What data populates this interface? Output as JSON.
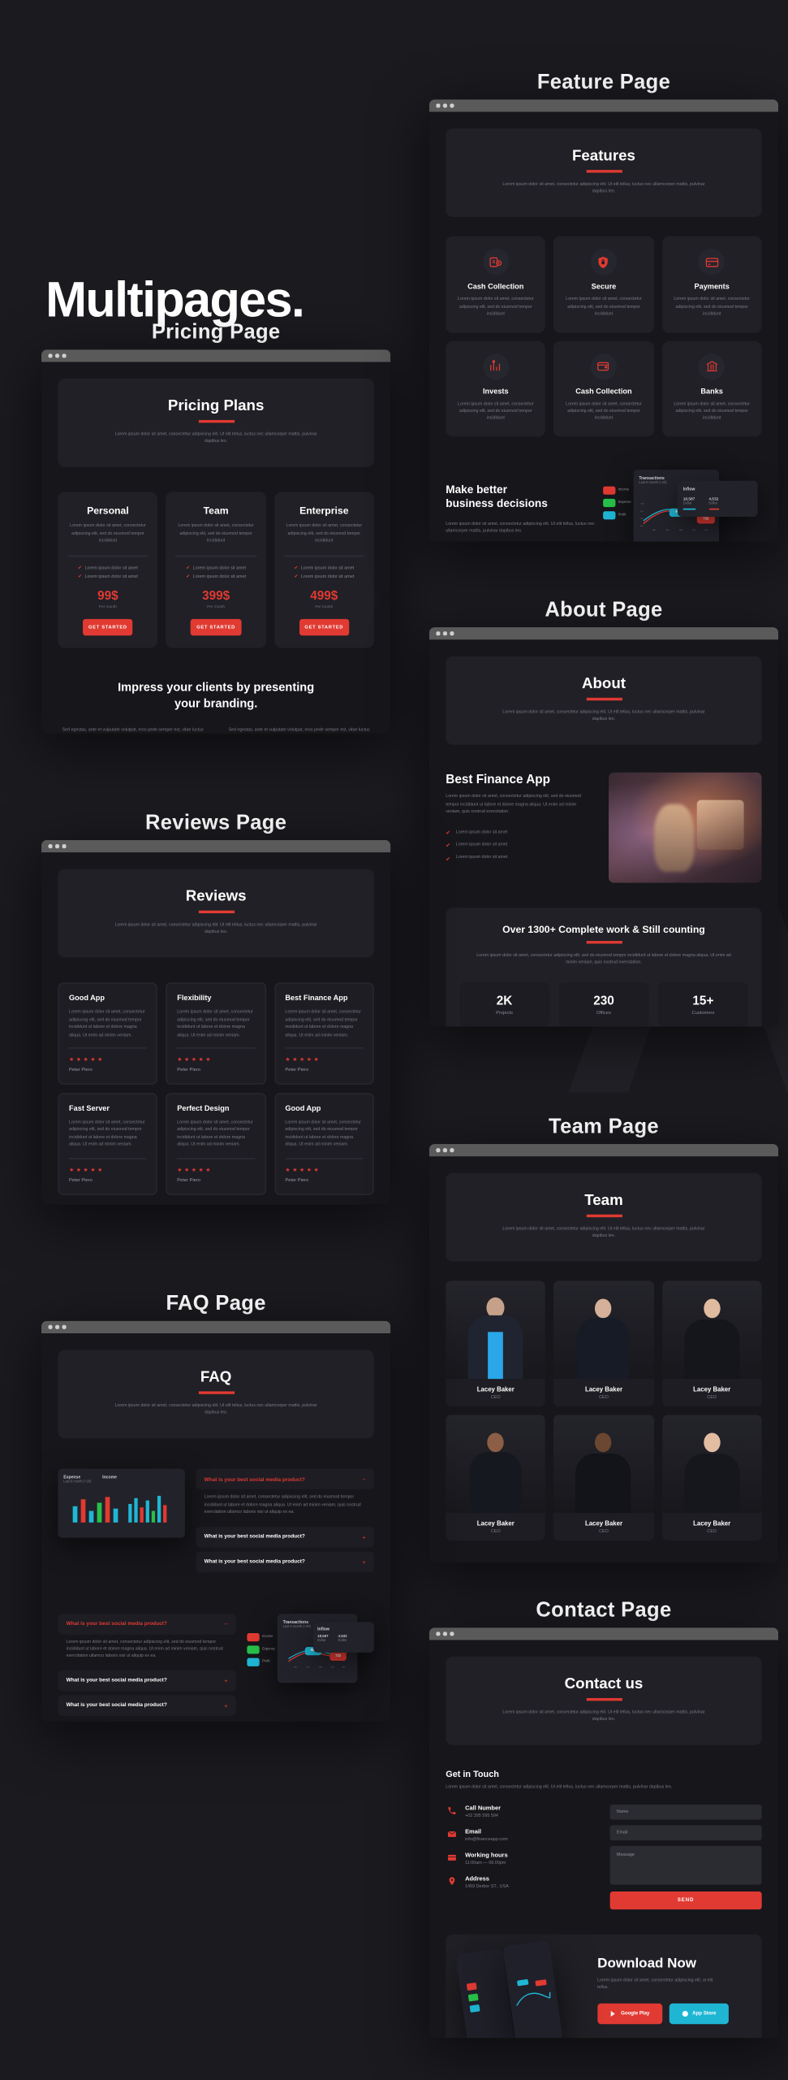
{
  "headline": "Multipages.",
  "watermark": "A",
  "lorem": {
    "short": "Lorem ipsum dolor sit amet, consectetur adipiscing elit. Ut elit tellus, luctus nec ullamcorper mattis, pulvinar dapibus leo.",
    "card": "Lorem ipsum dolor sit amet, consectetur adipiscing elit, sed do eiusmod tempor incididunt",
    "feat": "Lorem ipsum dolor sit amet, consectetur adipiscing elit, sed do eiusmod tempor incididunt",
    "review": "Lorem ipsum dolor sit amet, consectetur adipiscing elit, sed do eiusmod tempor incididunt ut labore et dolore magna aliqua. Ut enim ad minim veniam.",
    "about": "Lorem ipsum dolor sit amet, consectetur adipiscing elit, sed do eiusmod tempor incididunt ut labore et dolore magna aliqua. Ut enim ad minim veniam, quis nostrud exercitation.",
    "counting": "Lorem ipsum dolor sit amet, consectetur adipiscing elit, sed do eiusmod tempor incididunt ut labore et dolore magna aliqua. Ut enim ad minim veniam, quis nostrud exercitation.",
    "impress": "Sed egestas, ante et vulputate volutpat, eros pede semper est, vitae luctus metus libero eu augue. Morbi purus libero, faucibus adipiscing, commodo quis, gravida id, est. Sed lectus. Praesent elementum hendrerit tortor.",
    "faq_answer": "Lorem ipsum dolor sit amet, consectetur adipiscing elit, sed do eiusmod tempor incididunt ut labore et dolore magna aliqua. Ut enim ad minim veniam, quis nostrud exercitation ullamco laboris nisi ut aliquip ex ea.",
    "download": "Lorem ipsum dolor sit amet, consectetur adipiscing elit, ut elit tellus."
  },
  "pages": {
    "pricing": {
      "title": "Pricing Page",
      "hero_heading": "Pricing Plans",
      "plans": [
        {
          "name": "Personal",
          "price": "99$",
          "per": "Per month",
          "features": [
            "Lorem ipsum dolor sit amet",
            "Lorem ipsum dolor sit amet"
          ],
          "cta": "GET STARTED"
        },
        {
          "name": "Team",
          "price": "399$",
          "per": "Per month",
          "features": [
            "Lorem ipsum dolor sit amet",
            "Lorem ipsum dolor sit amet"
          ],
          "cta": "GET STARTED"
        },
        {
          "name": "Enterprise",
          "price": "499$",
          "per": "Per month",
          "features": [
            "Lorem ipsum dolor sit amet",
            "Lorem ipsum dolor sit amet"
          ],
          "cta": "GET STARTED"
        }
      ],
      "impress_heading_line1": "Impress your clients by presenting",
      "impress_heading_line2": "your branding."
    },
    "feature": {
      "title": "Feature Page",
      "hero_heading": "Features",
      "cards": [
        {
          "name": "Cash Collection",
          "icon": "cash-collection-icon"
        },
        {
          "name": "Secure",
          "icon": "shield-lock-icon"
        },
        {
          "name": "Payments",
          "icon": "credit-card-icon"
        },
        {
          "name": "Invests",
          "icon": "invest-chart-icon"
        },
        {
          "name": "Cash Collection",
          "icon": "wallet-icon"
        },
        {
          "name": "Banks",
          "icon": "bank-icon"
        }
      ],
      "promo_heading_line1": "Make better",
      "promo_heading_line2": "business decisions"
    },
    "about": {
      "title": "About Page",
      "hero_heading": "About",
      "section_heading": "Best Finance App",
      "bullets": [
        "Lorem ipsum dolor sit amet",
        "Lorem ipsum dolor sit amet",
        "Lorem ipsum dolor sit amet"
      ],
      "counting_heading": "Over 1300+ Complete work & Still counting",
      "stats": [
        {
          "number": "2K",
          "label": "Projects"
        },
        {
          "number": "230",
          "label": "Offices"
        },
        {
          "number": "15+",
          "label": "Customers"
        }
      ]
    },
    "reviews": {
      "title": "Reviews Page",
      "hero_heading": "Reviews",
      "cards": [
        {
          "title": "Good App",
          "stars": "★★★★★",
          "author": "Peter Piero"
        },
        {
          "title": "Flexibility",
          "stars": "★★★★★",
          "author": "Peter Piero"
        },
        {
          "title": "Best Finance App",
          "stars": "★★★★★",
          "author": "Peter Piero"
        },
        {
          "title": "Fast Server",
          "stars": "★★★★★",
          "author": "Peter Piero"
        },
        {
          "title": "Perfect Design",
          "stars": "★★★★★",
          "author": "Peter Piero"
        },
        {
          "title": "Good App",
          "stars": "★★★★★",
          "author": "Peter Piero"
        }
      ]
    },
    "team": {
      "title": "Team Page",
      "hero_heading": "Team",
      "members": [
        {
          "name": "Lacey Baker",
          "role": "CEO"
        },
        {
          "name": "Lacey Baker",
          "role": "CEO"
        },
        {
          "name": "Lacey Baker",
          "role": "CEO"
        },
        {
          "name": "Lacey Baker",
          "role": "CEO"
        },
        {
          "name": "Lacey Baker",
          "role": "CEO"
        },
        {
          "name": "Lacey Baker",
          "role": "CEO"
        }
      ]
    },
    "faq": {
      "title": "FAQ Page",
      "hero_heading": "FAQ",
      "items": [
        {
          "question": "What is your best social media product?",
          "open": true,
          "sign": "−"
        },
        {
          "question": "What is your best social media product?",
          "open": false,
          "sign": "+"
        },
        {
          "question": "What is your best social media product?",
          "open": false,
          "sign": "+"
        },
        {
          "question": "What is your best social media product?",
          "open": true,
          "sign": "−"
        },
        {
          "question": "What is your best social media product?",
          "open": false,
          "sign": "+"
        },
        {
          "question": "What is your best social media product?",
          "open": false,
          "sign": "+"
        }
      ]
    },
    "contact": {
      "title": "Contact Page",
      "hero_heading": "Contact us",
      "get_in_touch": "Get in Touch",
      "info": [
        {
          "label": "Call Number",
          "value": "+02 395 595 594",
          "icon": "phone-icon"
        },
        {
          "label": "Email",
          "value": "info@financeapp.com",
          "icon": "envelope-icon"
        },
        {
          "label": "Working hours",
          "value": "11:00am — 06:00pm",
          "icon": "clock-icon"
        },
        {
          "label": "Address",
          "value": "1459 Derbor ST., USA",
          "icon": "map-pin-icon"
        }
      ],
      "form": {
        "name_placeholder": "Name",
        "email_placeholder": "Email",
        "message_placeholder": "Message",
        "send_label": "SEND"
      },
      "download_heading": "Download Now",
      "store_buttons": [
        {
          "label": "Google Play",
          "icon": "play-store-icon",
          "color": "#e03a32"
        },
        {
          "label": "App Store",
          "icon": "apple-icon",
          "color": "#1fb6d4"
        }
      ]
    }
  },
  "dashboard": {
    "transactions_title": "Transactions",
    "transactions_sub": "Last 6 month (+20)",
    "inflow_title": "Inflow",
    "inflow_value": "18,587",
    "inflow_sub": "Dollar",
    "outflow_value": "4,532",
    "outflow_sub": "Dollar",
    "legend": [
      {
        "label": "Income",
        "color": "#e03a32"
      },
      {
        "label": "Expense",
        "color": "#27c04a"
      },
      {
        "label": "Profit",
        "color": "#1fb6d4"
      }
    ],
    "y_ticks": [
      "1200",
      "900",
      "600",
      "300",
      "0"
    ],
    "x_ticks": [
      "JAN",
      "FEB",
      "MAR",
      "APR",
      "MAY"
    ],
    "tooltip_a": "996",
    "tooltip_b": "732"
  },
  "colors": {
    "accent": "#e03a32",
    "cyan": "#1fb6d4",
    "background": "#1a1a1f",
    "panel": "#202026",
    "screen": "#16161b"
  }
}
